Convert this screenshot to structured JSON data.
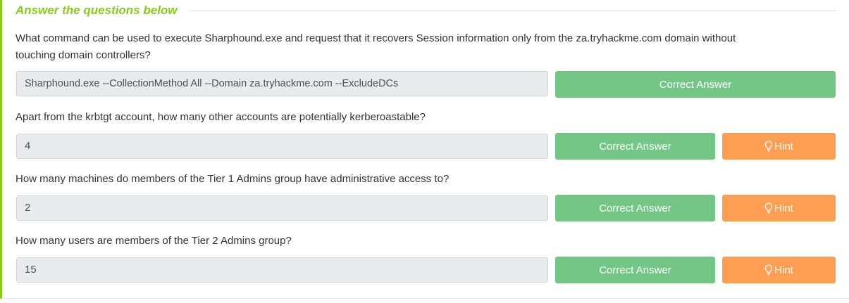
{
  "section": {
    "title": "Answer the questions below"
  },
  "questions": [
    {
      "text_line1": "What command can be used to execute Sharphound.exe and request that it recovers Session information only from the za.tryhackme.com domain without",
      "text_line2": "touching domain controllers?",
      "answer": "Sharphound.exe --CollectionMethod All --Domain za.tryhackme.com --ExcludeDCs",
      "correct_label": "Correct Answer",
      "has_hint": false
    },
    {
      "text": "Apart from the krbtgt account, how many other accounts are potentially kerberoastable?",
      "answer": "4",
      "correct_label": "Correct Answer",
      "hint_label": "Hint",
      "has_hint": true
    },
    {
      "text": "How many machines do members of the Tier 1 Admins group have administrative access to?",
      "answer": "2",
      "correct_label": "Correct Answer",
      "hint_label": "Hint",
      "has_hint": true
    },
    {
      "text": "How many users are members of the Tier 2 Admins group?",
      "answer": "15",
      "correct_label": "Correct Answer",
      "hint_label": "Hint",
      "has_hint": true
    }
  ],
  "colors": {
    "accent": "#88cc14",
    "correct_button": "#73c686",
    "hint_button": "#fd9e52",
    "input_background": "#e9ecef"
  },
  "icons": {
    "hint": "lightbulb-icon"
  }
}
